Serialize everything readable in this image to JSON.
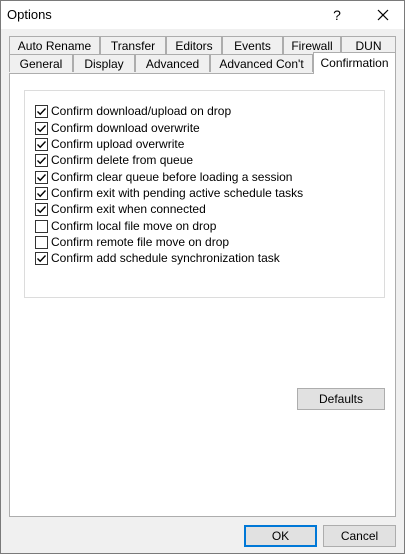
{
  "window": {
    "title": "Options",
    "help_label": "?"
  },
  "tabs_top": [
    "Auto Rename",
    "Transfer",
    "Editors",
    "Events",
    "Firewall",
    "DUN"
  ],
  "tabs_bottom": [
    "General",
    "Display",
    "Advanced",
    "Advanced Con't",
    "Confirmation"
  ],
  "active_tab": "Confirmation",
  "options": [
    {
      "label": "Confirm download/upload on drop",
      "checked": true
    },
    {
      "label": "Confirm download overwrite",
      "checked": true
    },
    {
      "label": "Confirm upload overwrite",
      "checked": true
    },
    {
      "label": "Confirm delete from queue",
      "checked": true
    },
    {
      "label": "Confirm clear queue before loading a session",
      "checked": true
    },
    {
      "label": "Confirm exit with pending active schedule tasks",
      "checked": true
    },
    {
      "label": "Confirm exit when connected",
      "checked": true
    },
    {
      "label": "Confirm local file move on drop",
      "checked": false
    },
    {
      "label": "Confirm remote file move on drop",
      "checked": false
    },
    {
      "label": "Confirm add schedule synchronization task",
      "checked": true
    }
  ],
  "buttons": {
    "defaults": "Defaults",
    "ok": "OK",
    "cancel": "Cancel"
  }
}
